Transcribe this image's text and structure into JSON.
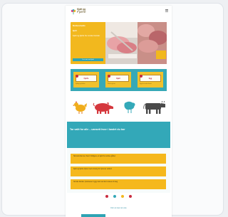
{
  "brand": {
    "small": "Kjøtt og",
    "big": "Fjørfe"
  },
  "hero": {
    "line1": "Nortura bedre",
    "line2": "kjøtt",
    "line3": "Kjøtt og fjørfe fra norske bønder",
    "cta": "Les mer om kjøtt"
  },
  "tiles": [
    {
      "label": "Fjørfe",
      "caption": "Kylling og kalkun"
    },
    {
      "label": "Kjøtt",
      "caption": "Storfe og lam"
    },
    {
      "label": "Egg",
      "caption": "Egg fra norske høner"
    }
  ],
  "animals": [
    "chicken-icon",
    "pig-icon",
    "turkey-icon",
    "cow-icon"
  ],
  "banner": "Tar valit for alle – uansett hvor i landet du bor",
  "bars": [
    "Skrivebordet sier livet til tidligere en kjøtt fra norske gårder",
    "Kjøtt og fjørfe dyrket med omsorg for dyrenes velferd",
    "Norske bønder produserer trygg mat med kort reisevei til deg"
  ],
  "link": "Finn ut mer om oss",
  "colors": {
    "yellow": "#f2b81e",
    "teal": "#33a8b8",
    "red": "#c92c3f"
  }
}
